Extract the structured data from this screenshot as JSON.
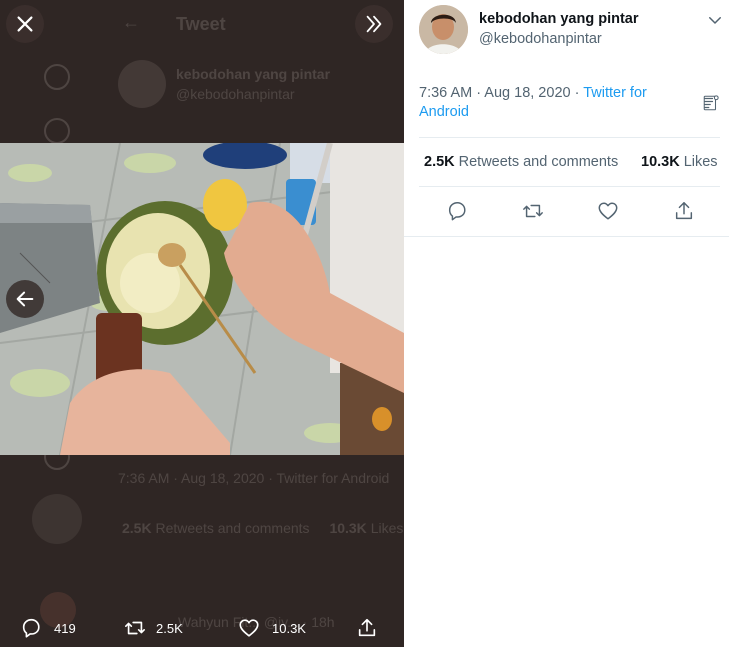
{
  "viewer": {
    "background_page": {
      "title": "Tweet",
      "author_name": "kebodohan yang pintar",
      "author_handle": "@kebodohanpintar",
      "meta": "7:36 AM · Aug 18, 2020 · Twitter for Android",
      "retweets_count": "2.5K",
      "retweets_label": "Retweets and comments",
      "likes_count": "10.3K",
      "likes_label": "Likes",
      "reply_preview": "Wahyun Fit... @iv... · 18h"
    },
    "actions": {
      "reply_count": "419",
      "retweet_count": "2.5K",
      "like_count": "10.3K"
    }
  },
  "tweet": {
    "author_name": "kebodohan yang pintar",
    "author_handle": "@kebodohanpintar",
    "time": "7:36 AM",
    "date": "Aug 18, 2020",
    "source": "Twitter for Android",
    "retweets_count": "2.5K",
    "retweets_label": "Retweets and comments",
    "likes_count": "10.3K",
    "likes_label": "Likes"
  },
  "icons": {
    "close": "close-icon",
    "expand": "chevron-double-right-icon",
    "prev": "arrow-left-icon",
    "reply": "reply-icon",
    "retweet": "retweet-icon",
    "like": "heart-icon",
    "share": "share-icon",
    "more": "chevron-down-icon",
    "analytics": "analytics-icon"
  },
  "colors": {
    "accent": "#1d9bf0",
    "overlay": "#2f2624",
    "text_primary": "#0f1419",
    "text_secondary": "#536471"
  }
}
